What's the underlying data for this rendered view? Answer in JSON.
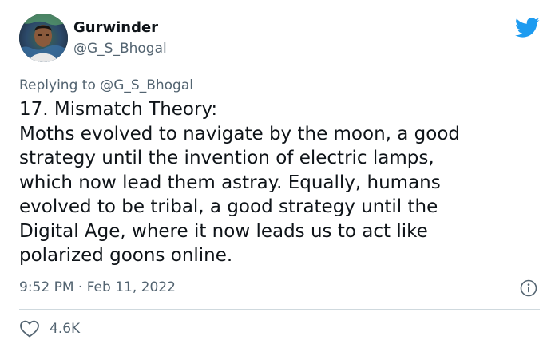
{
  "author": {
    "display_name": "Gurwinder",
    "handle": "@G_S_Bhogal",
    "avatar_icon": "user-avatar-photo"
  },
  "reply": {
    "prefix": "Replying to",
    "mention": "@G_S_Bhogal"
  },
  "tweet": {
    "lines": [
      "17. Mismatch Theory:",
      "Moths evolved to navigate by the moon, a good",
      "strategy until the invention of electric lamps,",
      "which now lead them astray. Equally, humans",
      "evolved to be tribal, a good strategy until the",
      "Digital Age, where it now leads us to act like",
      "polarized goons online."
    ],
    "timestamp": "9:52 PM · Feb 11, 2022"
  },
  "engagement": {
    "likes": "4.6K"
  },
  "icons": {
    "brand": "twitter-bird-icon",
    "info": "info-icon",
    "like": "heart-icon"
  },
  "colors": {
    "brand": "#1d9bf0",
    "text": "#0f1419",
    "secondary": "#536471",
    "divider": "#cfd9de"
  }
}
